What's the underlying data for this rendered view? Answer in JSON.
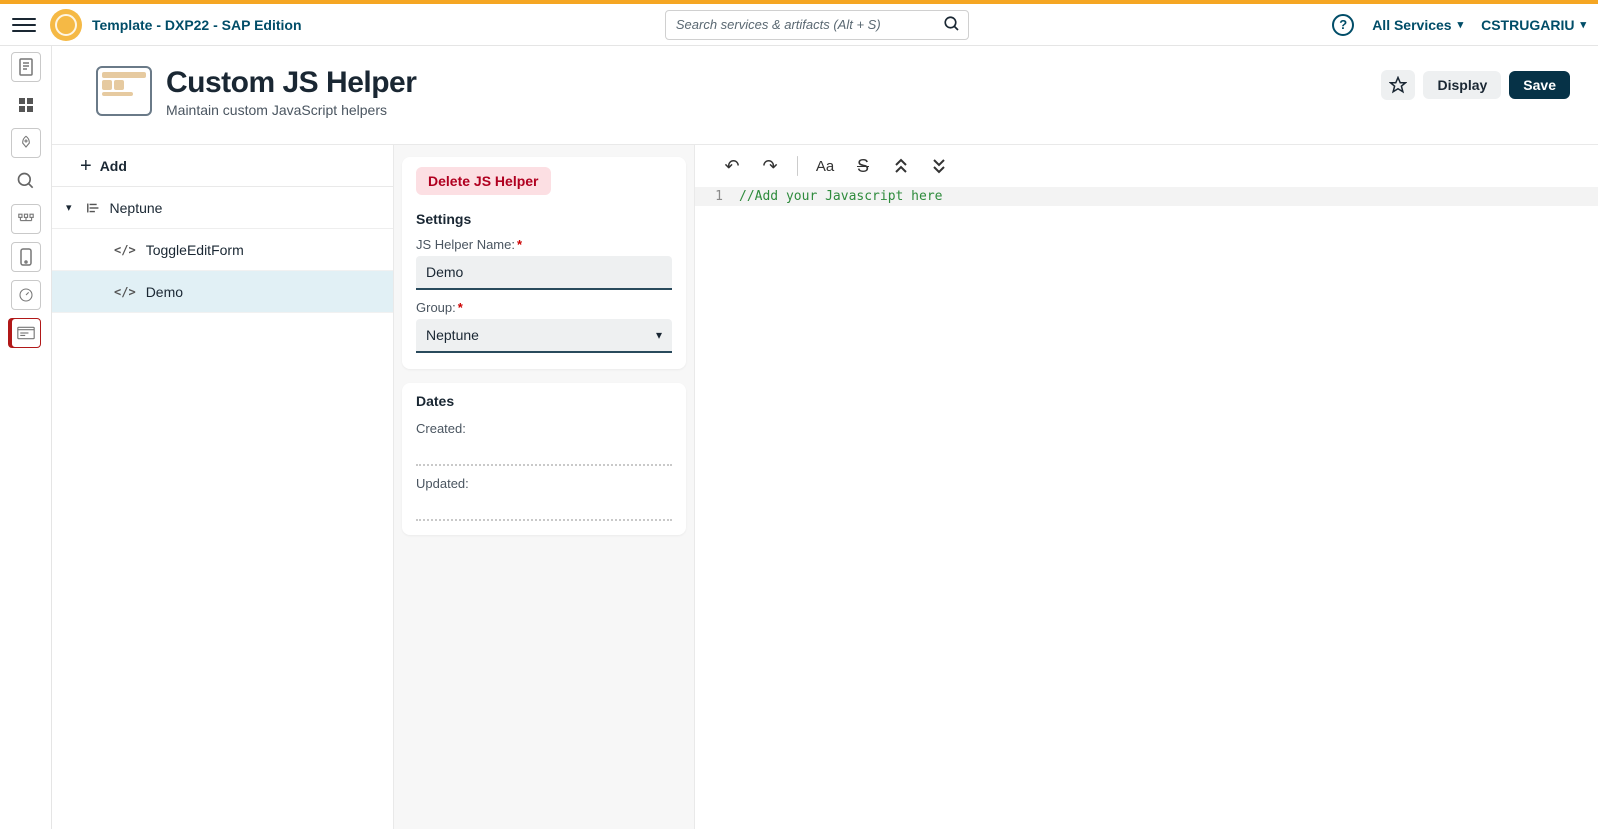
{
  "topbar": {
    "app_title": "Template  - DXP22 - SAP Edition",
    "search_placeholder": "Search services & artifacts (Alt + S)",
    "all_services": "All Services",
    "username": "CSTRUGARIU"
  },
  "page": {
    "title": "Custom JS Helper",
    "subtitle": "Maintain custom JavaScript helpers",
    "display_btn": "Display",
    "save_btn": "Save"
  },
  "tree": {
    "add_label": "Add",
    "group_label": "Neptune",
    "items": [
      {
        "label": "ToggleEditForm"
      },
      {
        "label": "Demo"
      }
    ]
  },
  "form": {
    "delete_btn": "Delete JS Helper",
    "settings_title": "Settings",
    "name_label": "JS Helper Name:",
    "name_value": "Demo",
    "group_label": "Group:",
    "group_value": "Neptune",
    "dates_title": "Dates",
    "created_label": "Created:",
    "updated_label": "Updated:"
  },
  "editor": {
    "line1_no": "1",
    "line1_text": "//Add your Javascript here"
  }
}
